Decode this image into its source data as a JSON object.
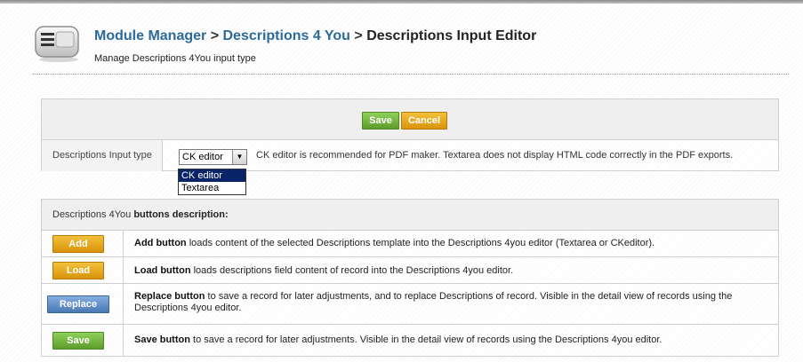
{
  "header": {
    "breadcrumb_module_manager": "Module Manager",
    "breadcrumb_separator_1": ">",
    "breadcrumb_descriptions": "Descriptions 4 You",
    "breadcrumb_separator_2": ">",
    "breadcrumb_current": "Descriptions Input Editor",
    "subtitle": "Manage Descriptions 4You input type"
  },
  "toolbar": {
    "save_label": "Save",
    "cancel_label": "Cancel"
  },
  "input_type": {
    "label": "Descriptions Input type",
    "selected_value": "CK editor",
    "options": [
      "CK editor",
      "Textarea"
    ],
    "note": "CK editor is recommended for PDF maker. Textarea does not display HTML code correctly in the PDF exports."
  },
  "buttons_description": {
    "header_prefix": "Descriptions 4You ",
    "header_bold": "buttons description:",
    "rows": [
      {
        "button_label": "Add",
        "title": "Add button",
        "text": " loads content of the selected Descriptions template into the Descriptions 4you editor (Textarea or CKeditor)."
      },
      {
        "button_label": "Load",
        "title": "Load button",
        "text": " loads descriptions field content of record into the Descriptions 4you editor."
      },
      {
        "button_label": "Replace",
        "title": "Replace button",
        "text": " to save a record for later adjustments, and to replace Descriptions of record. Visible in the detail view of records using the Descriptions 4you editor."
      },
      {
        "button_label": "Save",
        "title": "Save button",
        "text": " to save a record for later adjustments. Visible in the detail view of records using the Descriptions 4you editor."
      }
    ]
  },
  "colors": {
    "link_blue": "#2b6b9b",
    "button_green": "#6fb23a",
    "button_orange": "#e8a716",
    "button_blue": "#5a88c4",
    "dropdown_highlight": "#0a246a"
  },
  "icons": {
    "module_icon": "list-menu-icon",
    "dropdown_arrow": "chevron-down-icon"
  }
}
